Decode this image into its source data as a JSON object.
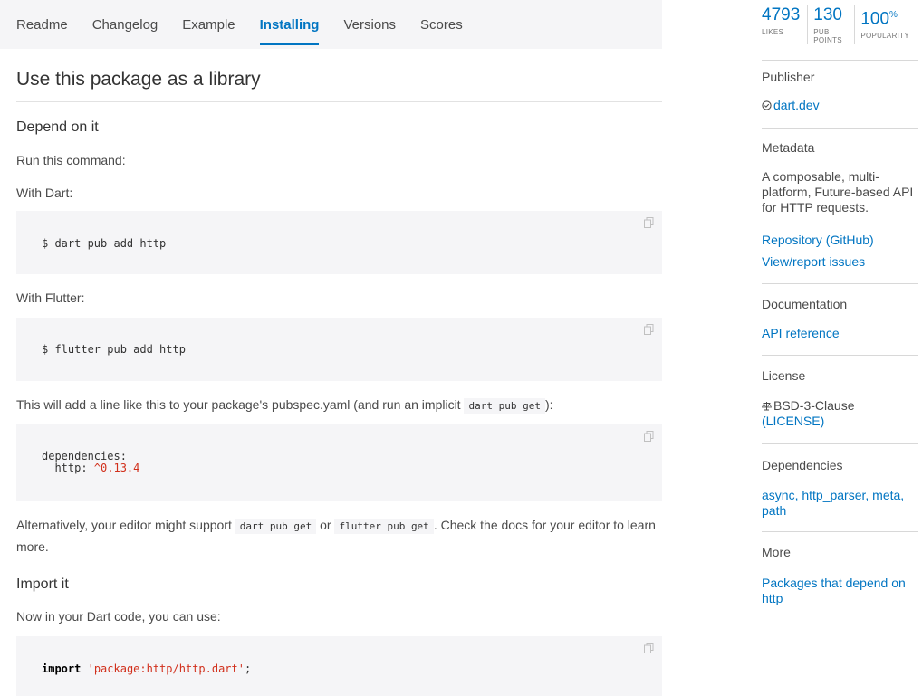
{
  "tabs": [
    "Readme",
    "Changelog",
    "Example",
    "Installing",
    "Versions",
    "Scores"
  ],
  "active_tab": "Installing",
  "title": "Use this package as a library",
  "depend": {
    "heading": "Depend on it",
    "run_text": "Run this command:",
    "with_dart": "With Dart:",
    "dart_cmd": "$ dart pub add http",
    "with_flutter": "With Flutter:",
    "flutter_cmd": "$ flutter pub add http",
    "note_prefix": "This will add a line like this to your package's pubspec.yaml (and run an implicit ",
    "note_code": "dart pub get",
    "note_suffix": "):",
    "yaml_line1": "dependencies:",
    "yaml_key": "  http: ",
    "yaml_version": "^0.13.4",
    "alt_prefix": "Alternatively, your editor might support ",
    "alt_code1": "dart pub get",
    "alt_or": " or ",
    "alt_code2": "flutter pub get",
    "alt_suffix": ". Check the docs for your editor to learn more."
  },
  "import": {
    "heading": "Import it",
    "text": "Now in your Dart code, you can use:",
    "keyword": "import",
    "path": "'package:http/http.dart'",
    "semicolon": ";"
  },
  "stats": {
    "likes": "4793",
    "likes_label": "LIKES",
    "points": "130",
    "points_label": "PUB POINTS",
    "popularity": "100",
    "popularity_unit": "%",
    "popularity_label": "POPULARITY"
  },
  "sidebar": {
    "publisher_heading": "Publisher",
    "publisher": "dart.dev",
    "metadata_heading": "Metadata",
    "description": "A composable, multi-platform, Future-based API for HTTP requests.",
    "repo_link": "Repository (GitHub)",
    "issues_link": "View/report issues",
    "documentation_heading": "Documentation",
    "api_link": "API reference",
    "license_heading": "License",
    "license_name": "BSD-3-Clause",
    "license_link": "(LICENSE)",
    "dependencies_heading": "Dependencies",
    "dependencies": "async, http_parser, meta, path",
    "more_heading": "More",
    "more_link": "Packages that depend on http"
  },
  "colors": {
    "accent": "#0175c2",
    "code_bg": "#f5f5f7",
    "string": "#d12f1b"
  }
}
